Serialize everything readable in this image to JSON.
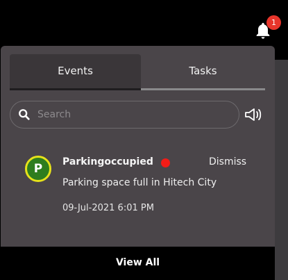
{
  "notifications": {
    "badge_count": "1"
  },
  "tabs": [
    {
      "label": "Events",
      "active": true
    },
    {
      "label": "Tasks",
      "active": false
    }
  ],
  "search": {
    "placeholder": "Search",
    "value": ""
  },
  "events": [
    {
      "avatar_letter": "P",
      "title": "Parkingoccupied",
      "status_color": "#f21c17",
      "dismiss_label": "Dismiss",
      "description": "Parking space full in Hitech City",
      "timestamp": "09-Jul-2021 6:01 PM"
    }
  ],
  "footer": {
    "view_all_label": "View All"
  },
  "icons": {
    "bell": "bell-icon",
    "search": "search-icon",
    "speaker": "speaker-icon"
  },
  "colors": {
    "panel": "#4a4549",
    "badge": "#e8352b",
    "avatar_fill": "#2e7d1e",
    "avatar_ring": "#e6e21a"
  }
}
